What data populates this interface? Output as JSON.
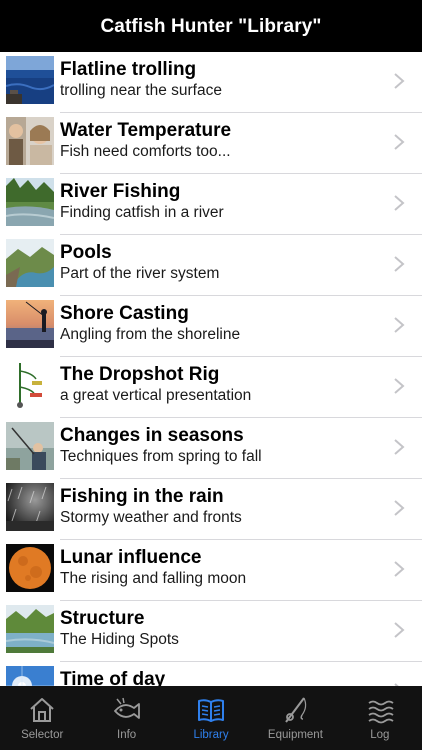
{
  "header": {
    "title": "Catfish Hunter \"Library\""
  },
  "list": {
    "items": [
      {
        "title": "Flatline trolling",
        "subtitle": "trolling near the surface",
        "thumb": "ocean-boat"
      },
      {
        "title": "Water Temperature",
        "subtitle": "Fish need comforts too...",
        "thumb": "people"
      },
      {
        "title": "River Fishing",
        "subtitle": "Finding catfish in a river",
        "thumb": "river-forest"
      },
      {
        "title": "Pools",
        "subtitle": "Part of the river system",
        "thumb": "river-pool"
      },
      {
        "title": "Shore Casting",
        "subtitle": "Angling from the shoreline",
        "thumb": "sunset-angler"
      },
      {
        "title": "The Dropshot Rig",
        "subtitle": "a great vertical presentation",
        "thumb": "rig-diagram"
      },
      {
        "title": "Changes in seasons",
        "subtitle": "Techniques from spring to fall",
        "thumb": "angler-season"
      },
      {
        "title": "Fishing in the rain",
        "subtitle": "Stormy weather and fronts",
        "thumb": "rain"
      },
      {
        "title": "Lunar influence",
        "subtitle": "The rising and falling moon",
        "thumb": "moon"
      },
      {
        "title": "Structure",
        "subtitle": "The Hiding Spots",
        "thumb": "structure-lake"
      },
      {
        "title": "Time of day",
        "subtitle": "",
        "thumb": "sky-sun"
      }
    ]
  },
  "tabs": [
    {
      "label": "Selector",
      "icon": "house-icon",
      "active": false
    },
    {
      "label": "Info",
      "icon": "fish-info-icon",
      "active": false
    },
    {
      "label": "Library",
      "icon": "book-icon",
      "active": true
    },
    {
      "label": "Equipment",
      "icon": "fishing-rod-icon",
      "active": false
    },
    {
      "label": "Log",
      "icon": "waves-log-icon",
      "active": false
    }
  ],
  "colors": {
    "nav_background": "#000000",
    "tab_background": "#121212",
    "tab_active": "#2f80ed",
    "tab_inactive": "#9a9a9a"
  }
}
